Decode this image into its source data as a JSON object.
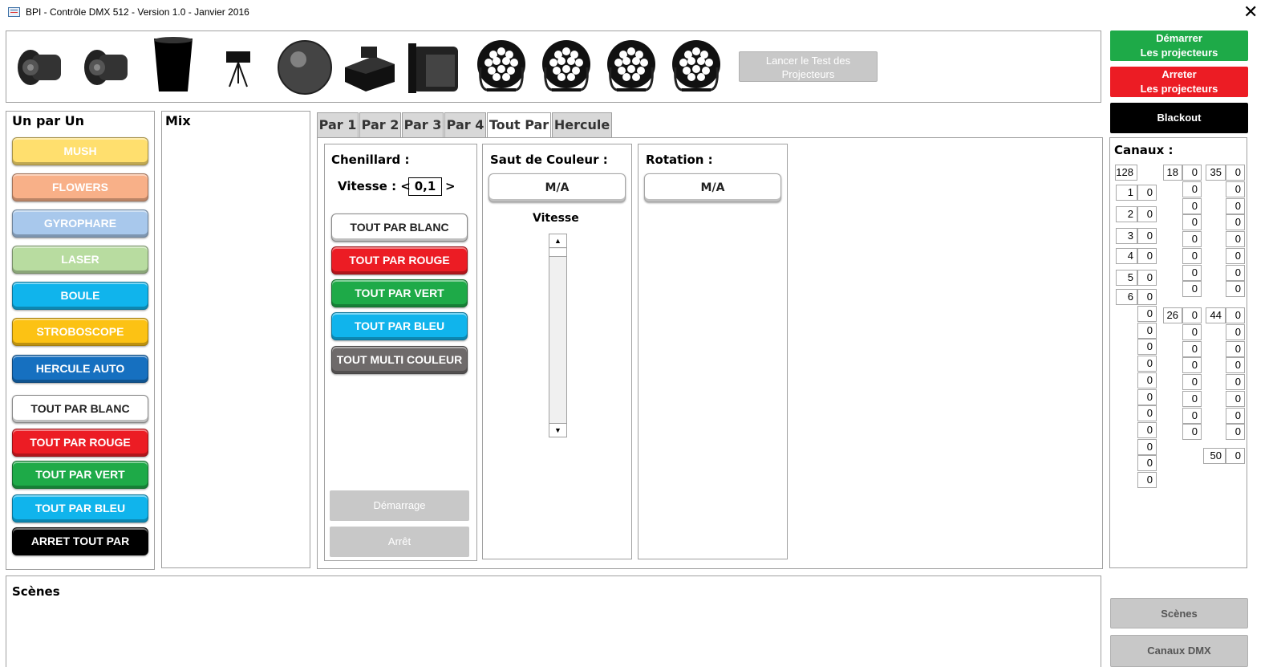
{
  "window": {
    "title": "BPI - Contrôle DMX 512 - Version 1.0 - Janvier 2016"
  },
  "toolbar": {
    "fixtures": [
      "projector-icon",
      "projector-icon",
      "can-light-icon",
      "laser-icon",
      "mirror-ball-icon",
      "smoke-machine-icon",
      "flood-light-icon",
      "led-par-icon",
      "led-par-icon",
      "led-par-icon",
      "led-par-icon"
    ],
    "test_label": "Lancer le Test des Projecteurs",
    "start_label": "Démarrer\nLes projecteurs",
    "stop_label": "Arreter\nLes projecteurs",
    "blackout_label": "Blackout"
  },
  "one_by_one": {
    "title": "Un par Un",
    "buttons": [
      {
        "label": "MUSH",
        "color": "#ffdf6e",
        "text": "#ffffff"
      },
      {
        "label": "FLOWERS",
        "color": "#f8b088",
        "text": "#ffffff"
      },
      {
        "label": "GYROPHARE",
        "color": "#a8c8ec",
        "text": "#ffffff"
      },
      {
        "label": "LASER",
        "color": "#b8dca0",
        "text": "#ffffff"
      },
      {
        "label": "BOULE",
        "color": "#10b4ec",
        "text": "#ffffff"
      },
      {
        "label": "STROBOSCOPE",
        "color": "#fcc214",
        "text": "#ffffff"
      },
      {
        "label": "HERCULE AUTO",
        "color": "#1670c0",
        "text": "#ffffff"
      },
      {
        "label": "TOUT PAR BLANC",
        "color": "#ffffff",
        "text": "#222222"
      },
      {
        "label": "TOUT PAR ROUGE",
        "color": "#ec1c24",
        "text": "#ffffff"
      },
      {
        "label": "TOUT PAR VERT",
        "color": "#1eaa48",
        "text": "#ffffff"
      },
      {
        "label": "TOUT PAR BLEU",
        "color": "#10b4ec",
        "text": "#ffffff"
      },
      {
        "label": "ARRET TOUT PAR",
        "color": "#000000",
        "text": "#ffffff"
      }
    ]
  },
  "mix": {
    "title": "Mix"
  },
  "tabs": [
    "Par 1",
    "Par 2",
    "Par 3",
    "Par 4",
    "Tout Par",
    "Hercule"
  ],
  "active_tab": 4,
  "chenillard": {
    "title": "Chenillard :",
    "speed_label": "Vitesse : <",
    "speed_value": "0,1",
    "speed_right": ">",
    "buttons": [
      {
        "label": "TOUT PAR BLANC",
        "color": "#ffffff",
        "text": "#222222"
      },
      {
        "label": "TOUT PAR ROUGE",
        "color": "#ec1c24",
        "text": "#ffffff"
      },
      {
        "label": "TOUT PAR VERT",
        "color": "#1eaa48",
        "text": "#ffffff"
      },
      {
        "label": "TOUT PAR BLEU",
        "color": "#10b4ec",
        "text": "#ffffff"
      },
      {
        "label": "TOUT MULTI COULEUR",
        "color": "#6e6a6a",
        "text": "#ffffff"
      }
    ],
    "start_label": "Démarrage",
    "stop_label": "Arrêt"
  },
  "color_jump": {
    "title": "Saut de Couleur :",
    "toggle_label": "M/A",
    "speed_label": "Vitesse"
  },
  "rotation": {
    "title": "Rotation :",
    "toggle_label": "M/A"
  },
  "channels": {
    "title": "Canaux :",
    "col1": {
      "head": "128",
      "rows": [
        [
          "1",
          "0"
        ],
        [
          "2",
          "0"
        ],
        [
          "3",
          "0"
        ],
        [
          "4",
          "0"
        ],
        [
          "5",
          "0"
        ],
        [
          "6",
          "0"
        ]
      ],
      "tail": [
        "0",
        "0",
        "0",
        "0",
        "0",
        "0",
        "0",
        "0",
        "0",
        "0",
        "0"
      ]
    },
    "col2": {
      "head": [
        "18",
        "0"
      ],
      "rows": [
        "0",
        "0",
        "0",
        "0",
        "0",
        "0",
        "0"
      ],
      "mid": [
        "26",
        "0"
      ],
      "rows2": [
        "0",
        "0",
        "0",
        "0",
        "0",
        "0",
        "0"
      ]
    },
    "col3": {
      "head": [
        "35",
        "0"
      ],
      "rows": [
        "0",
        "0",
        "0",
        "0",
        "0",
        "0",
        "0"
      ],
      "mid": [
        "44",
        "0"
      ],
      "rows2": [
        "0",
        "0",
        "0",
        "0",
        "0",
        "0",
        "0"
      ],
      "end": [
        "50",
        "0"
      ]
    }
  },
  "scenes": {
    "title": "Scènes"
  },
  "bottom": {
    "scenes_label": "Scènes",
    "dmx_label": "Canaux DMX"
  }
}
